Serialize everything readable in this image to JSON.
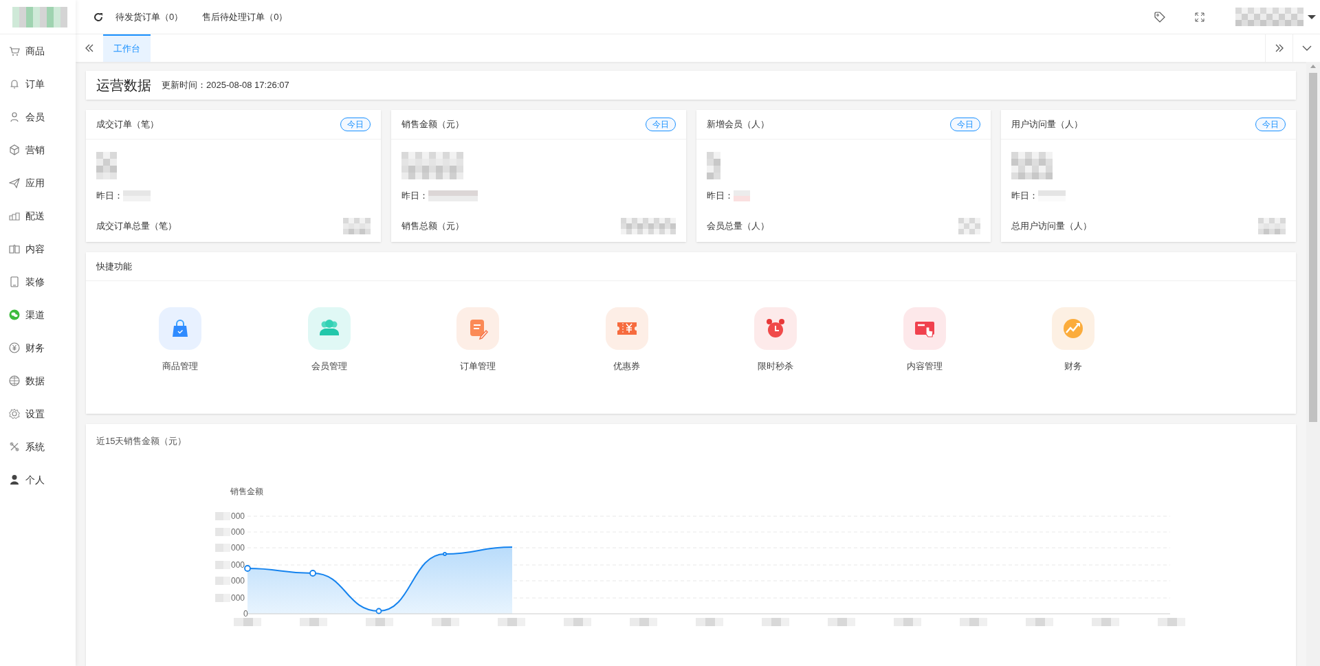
{
  "top_bar": {
    "links": [
      {
        "label": "待发货订单（0）"
      },
      {
        "label": "售后待处理订单（0）"
      }
    ]
  },
  "sidebar": {
    "items": [
      {
        "label": "商品"
      },
      {
        "label": "订单"
      },
      {
        "label": "会员"
      },
      {
        "label": "营销"
      },
      {
        "label": "应用"
      },
      {
        "label": "配送"
      },
      {
        "label": "内容"
      },
      {
        "label": "装修"
      },
      {
        "label": "渠道"
      },
      {
        "label": "财务"
      },
      {
        "label": "数据"
      },
      {
        "label": "设置"
      },
      {
        "label": "系统"
      },
      {
        "label": "个人"
      }
    ]
  },
  "tabs": [
    {
      "label": "工作台",
      "selected": true
    }
  ],
  "header": {
    "title": "运营数据",
    "updated": "更新时间：2025-08-08 17:26:07"
  },
  "stat_cards": [
    {
      "title": "成交订单（笔）",
      "badge": "今日",
      "yesterday_label": "昨日：",
      "total_label": "成交订单总量（笔）"
    },
    {
      "title": "销售金额（元）",
      "badge": "今日",
      "yesterday_label": "昨日：",
      "total_label": "销售总额（元）"
    },
    {
      "title": "新增会员（人）",
      "badge": "今日",
      "yesterday_label": "昨日：",
      "total_label": "会员总量（人）"
    },
    {
      "title": "用户访问量（人）",
      "badge": "今日",
      "yesterday_label": "昨日：",
      "total_label": "总用户访问量（人）"
    }
  ],
  "quick_functions": {
    "title": "快捷功能",
    "items": [
      {
        "label": "商品管理"
      },
      {
        "label": "会员管理"
      },
      {
        "label": "订单管理"
      },
      {
        "label": "优惠券"
      },
      {
        "label": "限时秒杀"
      },
      {
        "label": "内容管理"
      },
      {
        "label": "财务"
      }
    ]
  },
  "sales_chart": {
    "title": "近15天销售金额（元）",
    "axis_title": "销售金额",
    "y_tick_labels": [
      "000",
      "000",
      "000",
      "000",
      "000",
      "000",
      "0"
    ]
  }
}
